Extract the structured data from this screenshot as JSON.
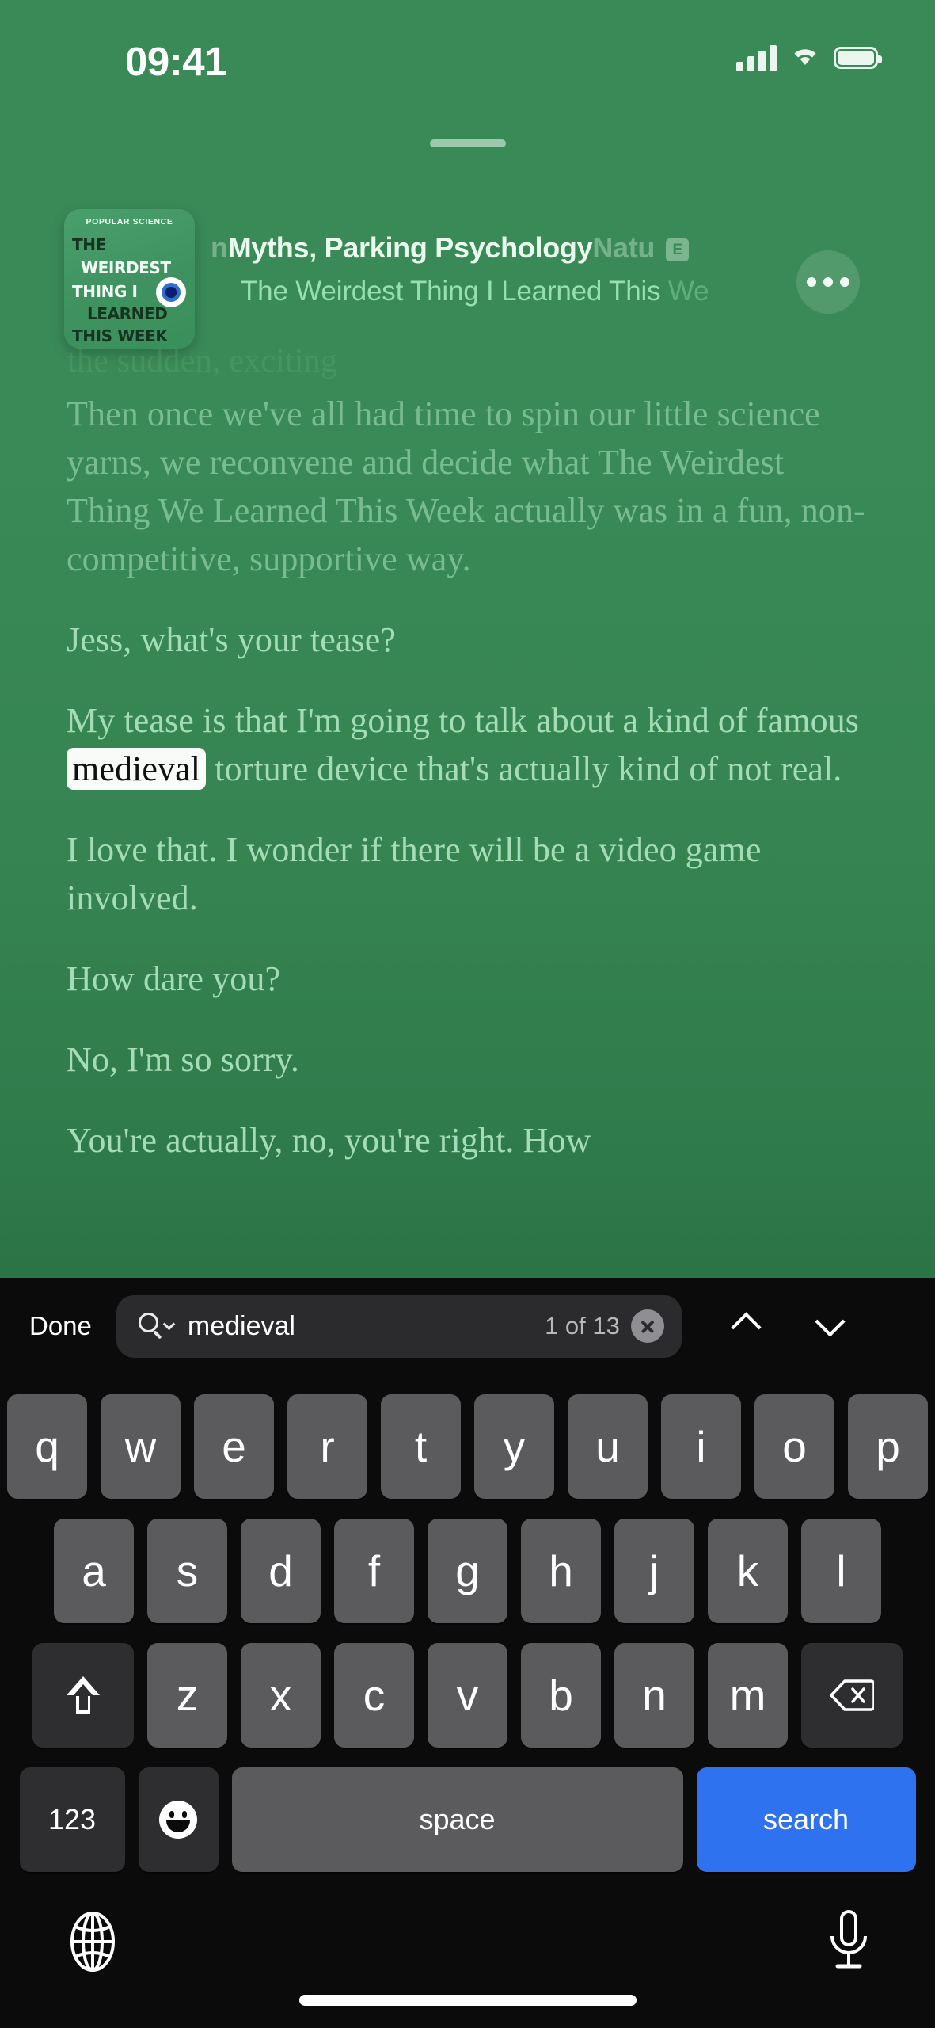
{
  "status_bar": {
    "time": "09:41",
    "cellular_icon": "cellular-bars-icon",
    "wifi_icon": "wifi-icon",
    "battery_icon": "battery-full-icon"
  },
  "now_playing": {
    "artwork": {
      "publisher": "POPULAR SCIENCE",
      "line1": "THE",
      "line2": "WEIRDEST",
      "line3": "THING I",
      "line4": "LEARNED",
      "line5": "THIS WEEK",
      "eye_icon": "eyeball-icon"
    },
    "episode_title_lead": "n",
    "episode_title": "Myths, Parking Psychology",
    "episode_title_tail": "Natu",
    "explicit_badge": "E",
    "show_title": "The Weirdest Thing I Learned This ",
    "show_title_tail": "We",
    "more_button_label": "more-options",
    "drag_handle_label": "sheet-drag-handle"
  },
  "transcript": {
    "faded_line": "the sudden, exciting",
    "paragraphs": [
      {
        "text": "Then once we've all had time to spin our little science yarns, we reconvene and decide what The Weirdest Thing We Learned This Week actually was in a fun, non-competitive, supportive way.",
        "dim": true
      },
      {
        "text": "Jess, what's your tease?",
        "dim": false
      },
      {
        "before": "My tease is that I'm going to talk about a kind of famous ",
        "highlight": "medieval",
        "after": " torture device that's actually kind of not real.",
        "dim": false
      },
      {
        "text": "I love that. I wonder if there will be a video game involved.",
        "dim": false
      },
      {
        "text": "How dare you?",
        "dim": false
      },
      {
        "text": "No, I'm so sorry.",
        "dim": false
      },
      {
        "text": "You're actually, no, you're right. How",
        "dim": false
      }
    ]
  },
  "find_bar": {
    "done_label": "Done",
    "search_icon": "magnifier-with-chevron-icon",
    "query": "medieval",
    "match_count": "1 of 13",
    "clear_icon": "clear-x-icon",
    "previous_icon": "chevron-up-icon",
    "next_icon": "chevron-down-icon"
  },
  "keyboard": {
    "row1": [
      "q",
      "w",
      "e",
      "r",
      "t",
      "y",
      "u",
      "i",
      "o",
      "p"
    ],
    "row2": [
      "a",
      "s",
      "d",
      "f",
      "g",
      "h",
      "j",
      "k",
      "l"
    ],
    "row3": [
      "z",
      "x",
      "c",
      "v",
      "b",
      "n",
      "m"
    ],
    "shift_icon": "shift-arrow-icon",
    "backspace_icon": "backspace-icon",
    "numbers_label": "123",
    "emoji_icon": "emoji-smiley-icon",
    "space_label": "space",
    "return_label": "search"
  },
  "bottom_bar": {
    "globe_icon": "globe-icon",
    "dictation_icon": "microphone-icon",
    "home_indicator": "home-indicator"
  },
  "colors": {
    "player_bg_top": "#3a8a58",
    "player_bg_bottom": "#2c7647",
    "transcript_text": "#a3dcb6",
    "accent_blue": "#2f72f0",
    "keyboard_bg": "#0b0b0b",
    "key_bg": "#5b5b5d",
    "key_dark_bg": "#2e2e30",
    "highlight_bg": "#f8fbf8"
  }
}
